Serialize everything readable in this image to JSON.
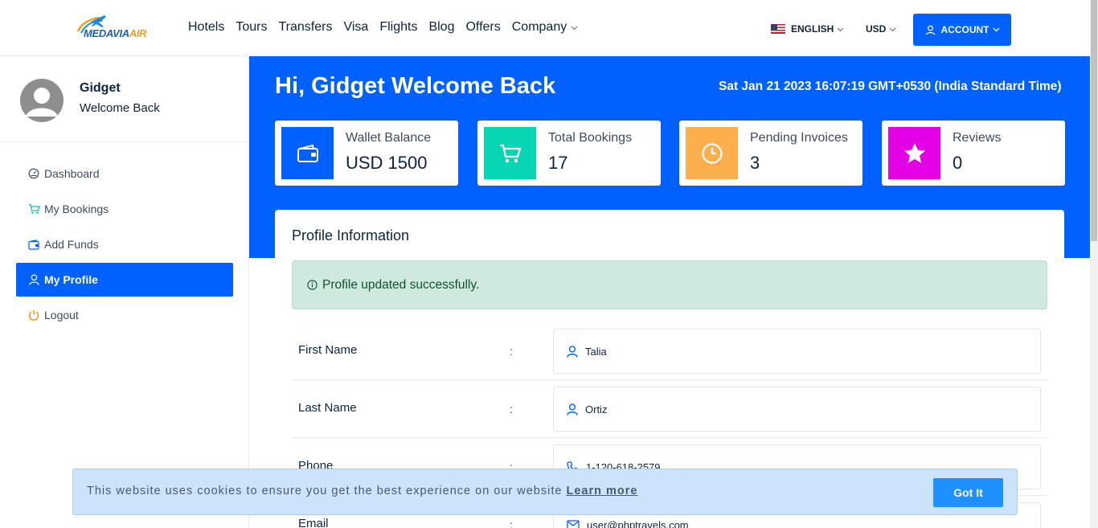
{
  "brand": {
    "logo_part1": "MEDAVIA",
    "logo_part2": "AIR"
  },
  "nav": {
    "items": [
      "Hotels",
      "Tours",
      "Transfers",
      "Visa",
      "Flights",
      "Blog",
      "Offers",
      "Company"
    ]
  },
  "header": {
    "language": "ENGLISH",
    "currency": "USD",
    "account_label": "ACCOUNT"
  },
  "sidebar": {
    "user_name": "Gidget",
    "user_subtitle": "Welcome Back",
    "items": [
      {
        "label": "Dashboard",
        "icon": "speedometer-icon",
        "active": false
      },
      {
        "label": "My Bookings",
        "icon": "cart-icon",
        "active": false
      },
      {
        "label": "Add Funds",
        "icon": "wallet-icon",
        "active": false
      },
      {
        "label": "My Profile",
        "icon": "user-icon",
        "active": true
      },
      {
        "label": "Logout",
        "icon": "power-icon",
        "active": false
      }
    ]
  },
  "dashboard": {
    "greeting": "Hi, Gidget Welcome Back",
    "datetime": "Sat Jan 21 2023 16:07:19 GMT+0530 (India Standard Time)",
    "stats": [
      {
        "label": "Wallet Balance",
        "value": "USD 1500",
        "icon": "wallet-icon",
        "color": "#0061ff"
      },
      {
        "label": "Total Bookings",
        "value": "17",
        "icon": "cart-icon",
        "color": "#07d5b4"
      },
      {
        "label": "Pending Invoices",
        "value": "3",
        "icon": "clock-icon",
        "color": "#fcaf4c"
      },
      {
        "label": "Reviews",
        "value": "0",
        "icon": "star-icon",
        "color": "#e400e4"
      }
    ]
  },
  "profile": {
    "title": "Profile Information",
    "alert": "Profile updated successfully.",
    "fields": [
      {
        "label": "First Name",
        "value": "Talia",
        "icon": "user-icon"
      },
      {
        "label": "Last Name",
        "value": "Ortiz",
        "icon": "user-icon"
      },
      {
        "label": "Phone",
        "value": "1-120-618-2579",
        "icon": "phone-icon"
      },
      {
        "label": "Email",
        "value": "user@phptravels.com",
        "icon": "mail-icon"
      }
    ]
  },
  "cookie": {
    "text": "This website uses cookies to ensure you get the best experience on our website",
    "link": "Learn more",
    "button": "Got It"
  },
  "colors": {
    "primary": "#0061ff",
    "success_bg": "#cfe9de",
    "cookie_bg": "#cce4fb"
  }
}
